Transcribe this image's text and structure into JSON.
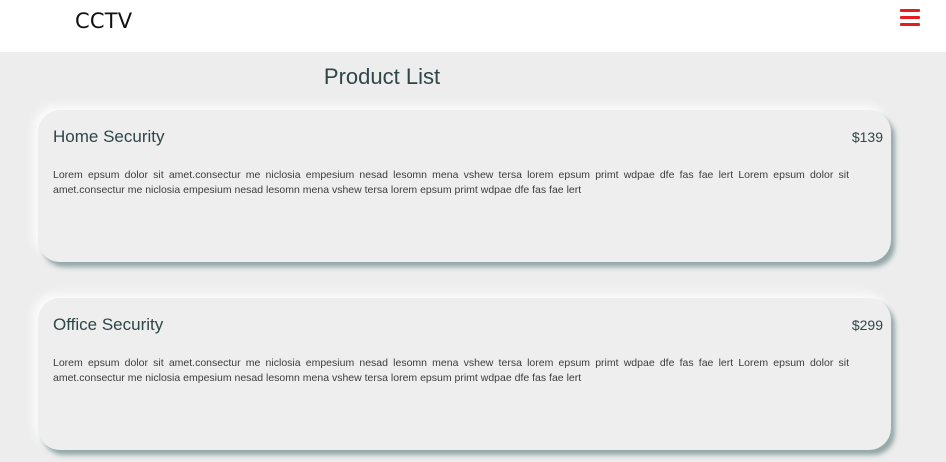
{
  "header": {
    "brand": "CCTV",
    "menu_icon": "hamburger-menu-icon",
    "menu_color": "#e21e1e"
  },
  "main": {
    "title": "Product List",
    "products": [
      {
        "title": "Home Security",
        "price": "$139",
        "description": "Lorem epsum dolor sit amet.consectur me niclosia empesium nesad lesomn mena vshew tersa lorem epsum primt wdpae dfe fas fae lert Lorem epsum dolor sit amet.consectur me niclosia empesium nesad lesomn mena vshew tersa lorem epsum primt wdpae dfe fas fae lert"
      },
      {
        "title": "Office Security",
        "price": "$299",
        "description": "Lorem epsum dolor sit amet.consectur me niclosia empesium nesad lesomn mena vshew tersa lorem epsum primt wdpae dfe fas fae lert Lorem epsum dolor sit amet.consectur me niclosia empesium nesad lesomn mena vshew tersa lorem epsum primt wdpae dfe fas fae lert"
      }
    ]
  }
}
